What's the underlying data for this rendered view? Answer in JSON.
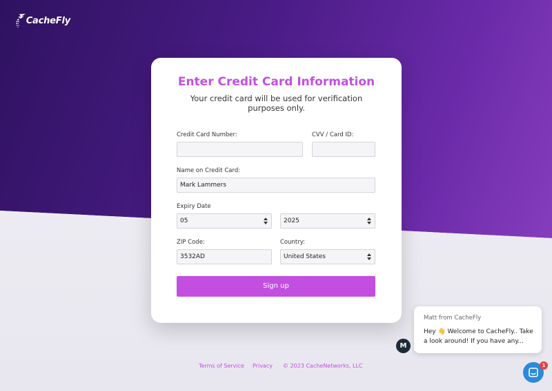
{
  "brand": {
    "name": "CacheFly"
  },
  "form": {
    "title": "Enter Credit Card Information",
    "subtitle": "Your credit card will be used for verification purposes only.",
    "card_number": {
      "label": "Credit Card Number:",
      "value": ""
    },
    "cvv": {
      "label": "CVV / Card ID:",
      "value": ""
    },
    "name_on_card": {
      "label": "Name on Credit Card:",
      "value": "Mark Lammers"
    },
    "expiry": {
      "label": "Expiry Date",
      "month": "05",
      "year": "2025"
    },
    "zip": {
      "label": "ZIP Code:",
      "value": "3532AD"
    },
    "country": {
      "label": "Country:",
      "value": "United States"
    },
    "submit_label": "Sign up"
  },
  "footer": {
    "terms": "Terms of Service",
    "privacy": "Privacy",
    "copyright": "© 2023 CacheNetworks, LLC"
  },
  "chat": {
    "from": "Matt from CacheFly",
    "message": "Hey 👋 Welcome to CacheFly.. Take a look around! If you have any...",
    "avatar_initial": "M",
    "unread_count": "1"
  },
  "colors": {
    "accent": "#c24fe0",
    "header_bg": "#4a1c86",
    "launcher": "#2b8ad9",
    "badge": "#e8423e"
  },
  "icons": [
    "cachefly-logo-icon",
    "select-arrows-icon",
    "chat-launcher-icon"
  ]
}
